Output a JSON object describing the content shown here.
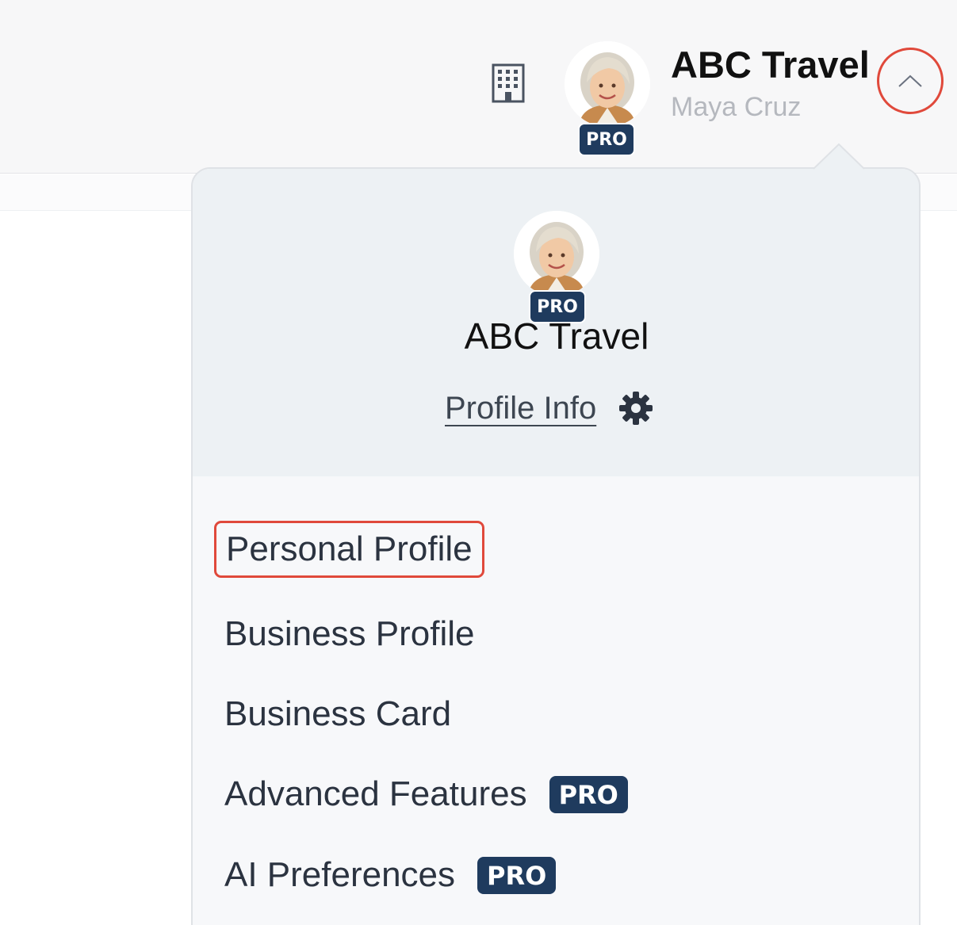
{
  "header": {
    "account_name": "ABC Travel",
    "user_name": "Maya Cruz",
    "pro_badge": "PRO",
    "icons": {
      "building": "building-icon",
      "toggle": "chevron-up-icon"
    }
  },
  "dropdown": {
    "account_name": "ABC Travel",
    "pro_badge": "PRO",
    "profile_info_label": "Profile Info",
    "settings_icon": "gear-icon",
    "menu_items": [
      {
        "label": "Personal Profile",
        "pro": false,
        "highlighted": true
      },
      {
        "label": "Business Profile",
        "pro": false,
        "highlighted": false
      },
      {
        "label": "Business Card",
        "pro": false,
        "highlighted": false
      },
      {
        "label": "Advanced Features",
        "pro": true,
        "badge": "PRO",
        "highlighted": false
      },
      {
        "label": "AI Preferences",
        "pro": true,
        "badge": "PRO",
        "highlighted": false
      }
    ]
  },
  "colors": {
    "accent_badge": "#1f3b5e",
    "highlight_outline": "#e0493b",
    "header_bg": "#f7f7f8",
    "dropdown_head_bg": "#edf1f4"
  }
}
